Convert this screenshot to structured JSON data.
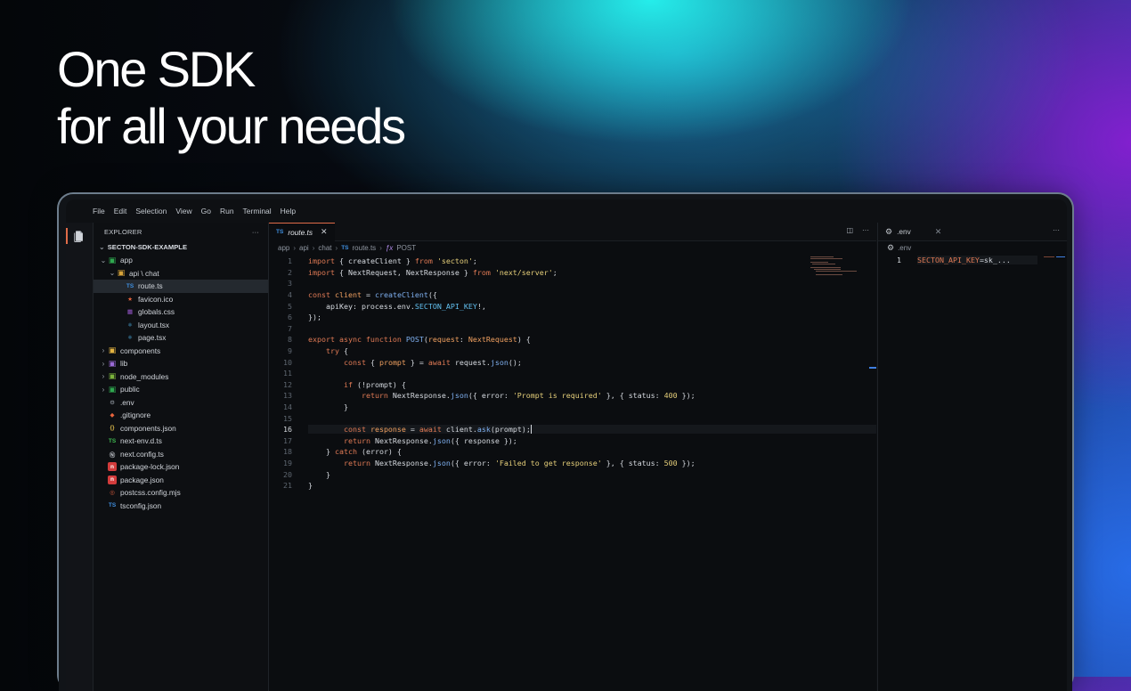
{
  "headline": {
    "line1": "One SDK",
    "line2": "for all your needs"
  },
  "menu": [
    "File",
    "Edit",
    "Selection",
    "View",
    "Go",
    "Run",
    "Terminal",
    "Help"
  ],
  "explorer": {
    "title": "EXPLORER",
    "more": "···",
    "project": "SECTON-SDK-EXAMPLE",
    "items": [
      {
        "label": "app",
        "depth": 1,
        "chevron": "⌄",
        "icon": "folder-app",
        "color": "#2fa84f"
      },
      {
        "label": "api \\ chat",
        "depth": 2,
        "chevron": "⌄",
        "icon": "folder-api",
        "color": "#d7a33a"
      },
      {
        "label": "route.ts",
        "depth": 3,
        "chevron": "",
        "icon": "ts",
        "color": "#3f8fe0",
        "selected": true
      },
      {
        "label": "favicon.ico",
        "depth": 3,
        "chevron": "",
        "icon": "favicon",
        "color": "#e8643c"
      },
      {
        "label": "globals.css",
        "depth": 3,
        "chevron": "",
        "icon": "css",
        "color": "#9b59d0"
      },
      {
        "label": "layout.tsx",
        "depth": 3,
        "chevron": "",
        "icon": "react",
        "color": "#4fb3e8"
      },
      {
        "label": "page.tsx",
        "depth": 3,
        "chevron": "",
        "icon": "react",
        "color": "#4fb3e8"
      },
      {
        "label": "components",
        "depth": 1,
        "chevron": "›",
        "icon": "folder-components",
        "color": "#e3b341"
      },
      {
        "label": "lib",
        "depth": 1,
        "chevron": "›",
        "icon": "folder-lib",
        "color": "#9a6ad6"
      },
      {
        "label": "node_modules",
        "depth": 1,
        "chevron": "›",
        "icon": "folder-node",
        "color": "#7bb33c"
      },
      {
        "label": "public",
        "depth": 1,
        "chevron": "›",
        "icon": "folder-public",
        "color": "#2fa84f"
      },
      {
        "label": ".env",
        "depth": 1,
        "chevron": "",
        "icon": "gear",
        "color": "#9aa1aa"
      },
      {
        "label": ".gitignore",
        "depth": 1,
        "chevron": "",
        "icon": "git",
        "color": "#e8643c"
      },
      {
        "label": "components.json",
        "depth": 1,
        "chevron": "",
        "icon": "json",
        "color": "#d9b84a"
      },
      {
        "label": "next-env.d.ts",
        "depth": 1,
        "chevron": "",
        "icon": "ts-green",
        "color": "#3fb950"
      },
      {
        "label": "next.config.ts",
        "depth": 1,
        "chevron": "",
        "icon": "next",
        "color": "#c9cdd3"
      },
      {
        "label": "package-lock.json",
        "depth": 1,
        "chevron": "",
        "icon": "npm",
        "color": "#d33c3c"
      },
      {
        "label": "package.json",
        "depth": 1,
        "chevron": "",
        "icon": "npm",
        "color": "#d33c3c"
      },
      {
        "label": "postcss.config.mjs",
        "depth": 1,
        "chevron": "",
        "icon": "postcss",
        "color": "#d35a3c"
      },
      {
        "label": "tsconfig.json",
        "depth": 1,
        "chevron": "",
        "icon": "tsconfig",
        "color": "#3f8fe0"
      }
    ]
  },
  "editor": {
    "tab": {
      "badge": "TS",
      "name": "route.ts",
      "close": "✕"
    },
    "actions": {
      "split": "◫",
      "more": "···"
    },
    "breadcrumb": [
      "app",
      "api",
      "chat"
    ],
    "breadcrumb_file": "route.ts",
    "breadcrumb_file_badge": "TS",
    "breadcrumb_symbol_icon": "ƒx",
    "breadcrumb_symbol": "POST",
    "active_line": 16,
    "lines": [
      [
        [
          "kw",
          "import"
        ],
        [
          "id",
          " { createClient } "
        ],
        [
          "kw",
          "from"
        ],
        [
          "id",
          " "
        ],
        [
          "str",
          "'secton'"
        ],
        [
          "id",
          ";"
        ]
      ],
      [
        [
          "kw",
          "import"
        ],
        [
          "id",
          " { NextRequest, NextResponse } "
        ],
        [
          "kw",
          "from"
        ],
        [
          "id",
          " "
        ],
        [
          "str",
          "'next/server'"
        ],
        [
          "id",
          ";"
        ]
      ],
      [],
      [
        [
          "kw",
          "const"
        ],
        [
          "id",
          " "
        ],
        [
          "vr",
          "client"
        ],
        [
          "id",
          " = "
        ],
        [
          "fn",
          "createClient"
        ],
        [
          "id",
          "({"
        ]
      ],
      [
        [
          "id",
          "    apiKey: process.env."
        ],
        [
          "env",
          "SECTON_API_KEY"
        ],
        [
          "id",
          "!,"
        ]
      ],
      [
        [
          "id",
          "});"
        ]
      ],
      [],
      [
        [
          "kw",
          "export async function"
        ],
        [
          "id",
          " "
        ],
        [
          "fn",
          "POST"
        ],
        [
          "id",
          "("
        ],
        [
          "vr",
          "request"
        ],
        [
          "id",
          ": "
        ],
        [
          "vr",
          "NextRequest"
        ],
        [
          "id",
          ") {"
        ]
      ],
      [
        [
          "id",
          "    "
        ],
        [
          "kw",
          "try"
        ],
        [
          "id",
          " {"
        ]
      ],
      [
        [
          "id",
          "        "
        ],
        [
          "kw",
          "const"
        ],
        [
          "id",
          " { "
        ],
        [
          "vr",
          "prompt"
        ],
        [
          "id",
          " } = "
        ],
        [
          "kw",
          "await"
        ],
        [
          "id",
          " request."
        ],
        [
          "fn",
          "json"
        ],
        [
          "id",
          "();"
        ]
      ],
      [],
      [
        [
          "id",
          "        "
        ],
        [
          "kw",
          "if"
        ],
        [
          "id",
          " (!prompt) {"
        ]
      ],
      [
        [
          "id",
          "            "
        ],
        [
          "kw",
          "return"
        ],
        [
          "id",
          " NextResponse."
        ],
        [
          "fn",
          "json"
        ],
        [
          "id",
          "({ error: "
        ],
        [
          "str",
          "'Prompt is required'"
        ],
        [
          "id",
          " }, { status: "
        ],
        [
          "num",
          "400"
        ],
        [
          "id",
          " });"
        ]
      ],
      [
        [
          "id",
          "        }"
        ]
      ],
      [],
      [
        [
          "id",
          "        "
        ],
        [
          "kw",
          "const"
        ],
        [
          "id",
          " "
        ],
        [
          "vr",
          "response"
        ],
        [
          "id",
          " = "
        ],
        [
          "kw",
          "await"
        ],
        [
          "id",
          " client."
        ],
        [
          "fn",
          "ask"
        ],
        [
          "id",
          "(prompt);"
        ]
      ],
      [
        [
          "id",
          "        "
        ],
        [
          "kw",
          "return"
        ],
        [
          "id",
          " NextResponse."
        ],
        [
          "fn",
          "json"
        ],
        [
          "id",
          "({ response });"
        ]
      ],
      [
        [
          "id",
          "    } "
        ],
        [
          "kw",
          "catch"
        ],
        [
          "id",
          " (error) {"
        ]
      ],
      [
        [
          "id",
          "        "
        ],
        [
          "kw",
          "return"
        ],
        [
          "id",
          " NextResponse."
        ],
        [
          "fn",
          "json"
        ],
        [
          "id",
          "({ error: "
        ],
        [
          "str",
          "'Failed to get response'"
        ],
        [
          "id",
          " }, { status: "
        ],
        [
          "num",
          "500"
        ],
        [
          "id",
          " });"
        ]
      ],
      [
        [
          "id",
          "    }"
        ]
      ],
      [
        [
          "id",
          "}"
        ]
      ]
    ]
  },
  "env_editor": {
    "tab_name": ".env",
    "close": "✕",
    "more": "···",
    "breadcrumb": ".env",
    "line_number": "1",
    "key": "SECTON_API_KEY",
    "value": "=sk_..."
  }
}
